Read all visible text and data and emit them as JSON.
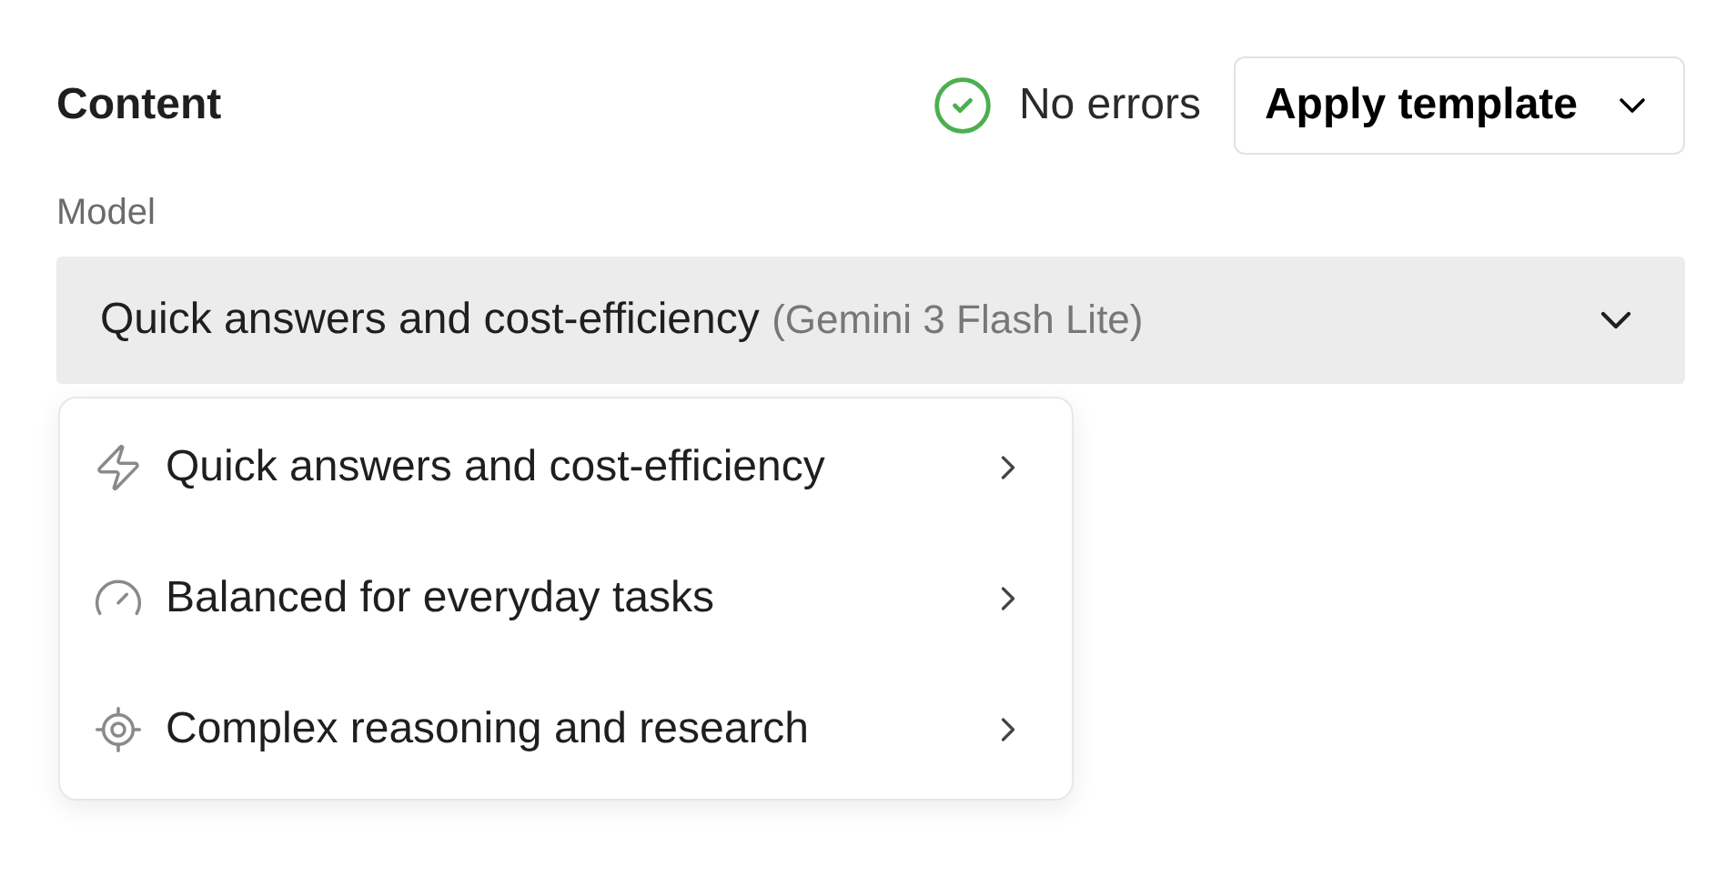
{
  "header": {
    "title": "Content",
    "status": "No errors",
    "template_button": "Apply template"
  },
  "model": {
    "label": "Model",
    "value": "Quick answers and cost-efficiency",
    "hint": "(Gemini 3 Flash Lite)",
    "expanded": true
  },
  "menu": [
    {
      "kind": "bolt",
      "label": "Quick answers and cost-efficiency"
    },
    {
      "kind": "gauge",
      "label": "Balanced for everyday tasks"
    },
    {
      "kind": "target",
      "label": "Complex reasoning and research"
    }
  ]
}
